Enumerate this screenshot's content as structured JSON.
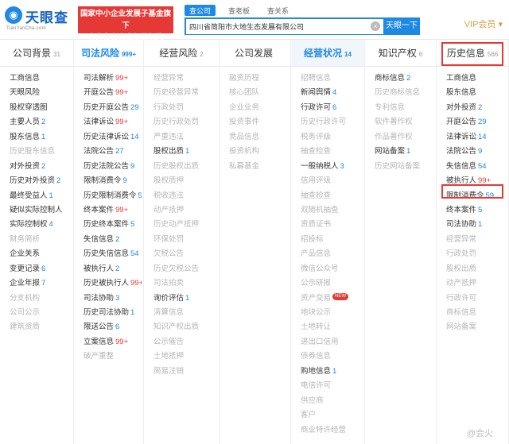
{
  "header": {
    "logo_text": "天眼查",
    "logo_sub": "TianYanCha.com",
    "banner_line1": "国家中小企业发展子基金旗下",
    "banner_line2": "官方备案企业征信机构",
    "search_tabs": [
      "查公司",
      "查老板",
      "查关系"
    ],
    "search_value": "四川省简阳市大地生态发展有限公司",
    "search_button": "天眼一下",
    "vip_label": "VIP会员 ▾"
  },
  "columns": [
    {
      "title": "公司背景",
      "count": "31",
      "style": "normal",
      "items": [
        {
          "t": "工商信息",
          "n": "",
          "g": false
        },
        {
          "t": "天眼风险",
          "n": "",
          "g": false
        },
        {
          "t": "股权穿透图",
          "n": "",
          "g": false
        },
        {
          "t": "主要人员",
          "n": "2",
          "g": false
        },
        {
          "t": "股东信息",
          "n": "1",
          "g": false
        },
        {
          "t": "历史股东信息",
          "n": "",
          "g": true
        },
        {
          "t": "对外投资",
          "n": "2",
          "g": false
        },
        {
          "t": "历史对外投资",
          "n": "2",
          "g": false
        },
        {
          "t": "最终受益人",
          "n": "1",
          "g": false
        },
        {
          "t": "疑似实际控制人",
          "n": "",
          "g": false
        },
        {
          "t": "实际控制权",
          "n": "4",
          "g": false
        },
        {
          "t": "财务简析",
          "n": "",
          "g": true
        },
        {
          "t": "企业关系",
          "n": "",
          "g": false
        },
        {
          "t": "变更记录",
          "n": "6",
          "g": false
        },
        {
          "t": "企业年报",
          "n": "7",
          "g": false
        },
        {
          "t": "分支机构",
          "n": "",
          "g": true
        },
        {
          "t": "公司公示",
          "n": "",
          "g": true
        },
        {
          "t": "建筑资质",
          "n": "",
          "g": true
        }
      ]
    },
    {
      "title": "司法风险",
      "count": "999+",
      "style": "blue",
      "items": [
        {
          "t": "司法解析",
          "n": "99+",
          "g": false
        },
        {
          "t": "开庭公告",
          "n": "99+",
          "g": false
        },
        {
          "t": "历史开庭公告",
          "n": "29",
          "g": false
        },
        {
          "t": "法律诉讼",
          "n": "99+",
          "g": false
        },
        {
          "t": "历史法律诉讼",
          "n": "14",
          "g": false
        },
        {
          "t": "法院公告",
          "n": "27",
          "g": false
        },
        {
          "t": "历史法院公告",
          "n": "9",
          "g": false
        },
        {
          "t": "限制消费令",
          "n": "9",
          "g": false
        },
        {
          "t": "历史限制消费令",
          "n": "59",
          "g": false
        },
        {
          "t": "终本案件",
          "n": "99+",
          "g": false
        },
        {
          "t": "历史终本案件",
          "n": "5",
          "g": false
        },
        {
          "t": "失信信息",
          "n": "2",
          "g": false
        },
        {
          "t": "历史失信信息",
          "n": "54",
          "g": false
        },
        {
          "t": "被执行人",
          "n": "2",
          "g": false
        },
        {
          "t": "历史被执行人",
          "n": "99+",
          "g": false
        },
        {
          "t": "司法协助",
          "n": "3",
          "g": false
        },
        {
          "t": "历史司法协助",
          "n": "1",
          "g": false
        },
        {
          "t": "限送公告",
          "n": "6",
          "g": false
        },
        {
          "t": "立案信息",
          "n": "99+",
          "g": false
        },
        {
          "t": "破产重整",
          "n": "",
          "g": true
        }
      ]
    },
    {
      "title": "经营风险",
      "count": "2",
      "style": "normal",
      "items": [
        {
          "t": "经营异常",
          "n": "",
          "g": true
        },
        {
          "t": "历史经营异常",
          "n": "",
          "g": true
        },
        {
          "t": "行政处罚",
          "n": "",
          "g": true
        },
        {
          "t": "历史行政处罚",
          "n": "",
          "g": true
        },
        {
          "t": "严重违法",
          "n": "",
          "g": true
        },
        {
          "t": "股权出质",
          "n": "1",
          "g": false
        },
        {
          "t": "历史股权出质",
          "n": "",
          "g": true
        },
        {
          "t": "股权质押",
          "n": "",
          "g": true
        },
        {
          "t": "税收违法",
          "n": "",
          "g": true
        },
        {
          "t": "动产抵押",
          "n": "",
          "g": true
        },
        {
          "t": "历史动产抵押",
          "n": "",
          "g": true
        },
        {
          "t": "环保处罚",
          "n": "",
          "g": true
        },
        {
          "t": "欠税公告",
          "n": "",
          "g": true
        },
        {
          "t": "历史欠税公告",
          "n": "",
          "g": true
        },
        {
          "t": "司法拍卖",
          "n": "",
          "g": true
        },
        {
          "t": "询价评估",
          "n": "1",
          "g": false
        },
        {
          "t": "清算信息",
          "n": "",
          "g": true
        },
        {
          "t": "知识产权出质",
          "n": "",
          "g": true
        },
        {
          "t": "公示催告",
          "n": "",
          "g": true
        },
        {
          "t": "土地抵押",
          "n": "",
          "g": true
        },
        {
          "t": "简易注销",
          "n": "",
          "g": true
        }
      ]
    },
    {
      "title": "公司发展",
      "count": "",
      "style": "normal",
      "items": [
        {
          "t": "融资历程",
          "n": "",
          "g": true
        },
        {
          "t": "核心团队",
          "n": "",
          "g": true
        },
        {
          "t": "企业业务",
          "n": "",
          "g": true
        },
        {
          "t": "投资事件",
          "n": "",
          "g": true
        },
        {
          "t": "竞品信息",
          "n": "",
          "g": true
        },
        {
          "t": "投资机构",
          "n": "",
          "g": true
        },
        {
          "t": "私募基金",
          "n": "",
          "g": true
        }
      ]
    },
    {
      "title": "经营状况",
      "count": "14",
      "style": "blue-shade",
      "items": [
        {
          "t": "招聘信息",
          "n": "",
          "g": true
        },
        {
          "t": "新闻舆情",
          "n": "4",
          "g": false
        },
        {
          "t": "行政许可",
          "n": "6",
          "g": false
        },
        {
          "t": "历史行政许可",
          "n": "",
          "g": true
        },
        {
          "t": "税务评级",
          "n": "",
          "g": true
        },
        {
          "t": "抽查检查",
          "n": "",
          "g": true
        },
        {
          "t": "一般纳税人",
          "n": "3",
          "g": false
        },
        {
          "t": "信用评级",
          "n": "",
          "g": true
        },
        {
          "t": "抽查检查",
          "n": "",
          "g": true
        },
        {
          "t": "双随机抽查",
          "n": "",
          "g": true
        },
        {
          "t": "资质证书",
          "n": "",
          "g": true
        },
        {
          "t": "招投标",
          "n": "",
          "g": true
        },
        {
          "t": "产品信息",
          "n": "",
          "g": true
        },
        {
          "t": "微信公众号",
          "n": "",
          "g": true
        },
        {
          "t": "公示研报",
          "n": "",
          "g": true
        },
        {
          "t": "资产交易",
          "n": "",
          "g": true,
          "badge": "NEW"
        },
        {
          "t": "地块公示",
          "n": "",
          "g": true
        },
        {
          "t": "土地转让",
          "n": "",
          "g": true
        },
        {
          "t": "进出口信用",
          "n": "",
          "g": true
        },
        {
          "t": "债券信息",
          "n": "",
          "g": true
        },
        {
          "t": "购地信息",
          "n": "1",
          "g": false
        },
        {
          "t": "电信许可",
          "n": "",
          "g": true
        },
        {
          "t": "供应商",
          "n": "",
          "g": true
        },
        {
          "t": "客户",
          "n": "",
          "g": true
        },
        {
          "t": "商业特许经营",
          "n": "",
          "g": true
        }
      ]
    },
    {
      "title": "知识产权",
      "count": "6",
      "style": "normal",
      "items": [
        {
          "t": "商标信息",
          "n": "2",
          "g": false
        },
        {
          "t": "历史商标信息",
          "n": "",
          "g": true
        },
        {
          "t": "专利信息",
          "n": "",
          "g": true
        },
        {
          "t": "软件著作权",
          "n": "",
          "g": true
        },
        {
          "t": "作品著作权",
          "n": "",
          "g": true
        },
        {
          "t": "网站备案",
          "n": "1",
          "g": false
        },
        {
          "t": "历史网站备案",
          "n": "",
          "g": true
        }
      ]
    },
    {
      "title": "历史信息",
      "count": "566",
      "style": "normal",
      "items": [
        {
          "t": "工商信息",
          "n": "",
          "g": false
        },
        {
          "t": "股东信息",
          "n": "",
          "g": false
        },
        {
          "t": "对外投资",
          "n": "2",
          "g": false
        },
        {
          "t": "开庭公告",
          "n": "29",
          "g": false
        },
        {
          "t": "法律诉讼",
          "n": "14",
          "g": false
        },
        {
          "t": "法院公告",
          "n": "9",
          "g": false
        },
        {
          "t": "失信信息",
          "n": "54",
          "g": false
        },
        {
          "t": "被执行人",
          "n": "99+",
          "g": false
        },
        {
          "t": "限制消费令",
          "n": "59",
          "g": false
        },
        {
          "t": "终本案件",
          "n": "5",
          "g": false
        },
        {
          "t": "司法协助",
          "n": "1",
          "g": false
        },
        {
          "t": "经营异常",
          "n": "",
          "g": true
        },
        {
          "t": "行政处罚",
          "n": "",
          "g": true
        },
        {
          "t": "股权出质",
          "n": "",
          "g": true
        },
        {
          "t": "动产抵押",
          "n": "",
          "g": true
        },
        {
          "t": "行政许可",
          "n": "",
          "g": true
        },
        {
          "t": "商标信息",
          "n": "",
          "g": true
        },
        {
          "t": "网站备案",
          "n": "",
          "g": true
        }
      ]
    }
  ],
  "watermark": "@会火"
}
